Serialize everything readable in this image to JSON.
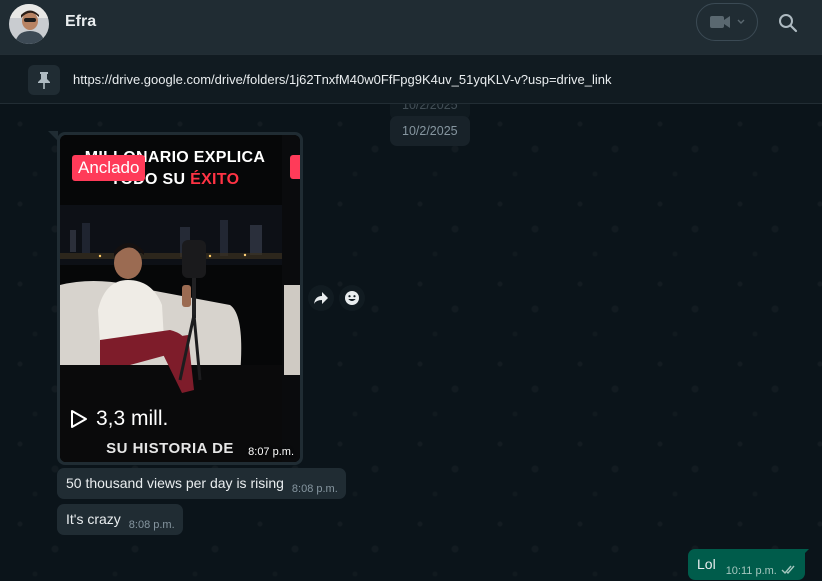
{
  "header": {
    "contact_name": "Efra",
    "avatar_icon": "avatar-photo",
    "video_icon": "video-camera-icon",
    "dropdown_icon": "chevron-down-icon",
    "search_icon": "search-icon"
  },
  "pinned": {
    "icon": "pin-icon",
    "link": "https://drive.google.com/drive/folders/1j62TnxfM40w0FfFpg9K4uv_51yqKLV-v?usp=drive_link"
  },
  "chat": {
    "date_ghost": "10/2/2025",
    "date_label": "10/2/2025",
    "video_message": {
      "tag": "Anclado",
      "headline_line1": "MILLONARIO EXPLICA",
      "headline_line2_prefix": "TODO SU ",
      "headline_line2_accent": "ÉXITO",
      "views": "3,3 mill.",
      "subheadline": "SU HISTORIA DE",
      "time": "8:07 p.m."
    },
    "actions": {
      "forward_icon": "forward-icon",
      "emoji_icon": "emoji-icon"
    },
    "messages": [
      {
        "text": "50 thousand views per day is rising",
        "time": "8:08 p.m.",
        "direction": "in"
      },
      {
        "text": "It's crazy",
        "time": "8:08 p.m.",
        "direction": "in"
      },
      {
        "text": "Lol",
        "time": "10:11 p.m.",
        "direction": "out",
        "status": "read"
      }
    ]
  },
  "colors": {
    "header_bg": "#202c33",
    "chat_bg": "#0b141a",
    "incoming_bubble": "#202c33",
    "outgoing_bubble": "#005c4b",
    "tag_red": "#ff3b59",
    "accent_red": "#ff3344"
  }
}
